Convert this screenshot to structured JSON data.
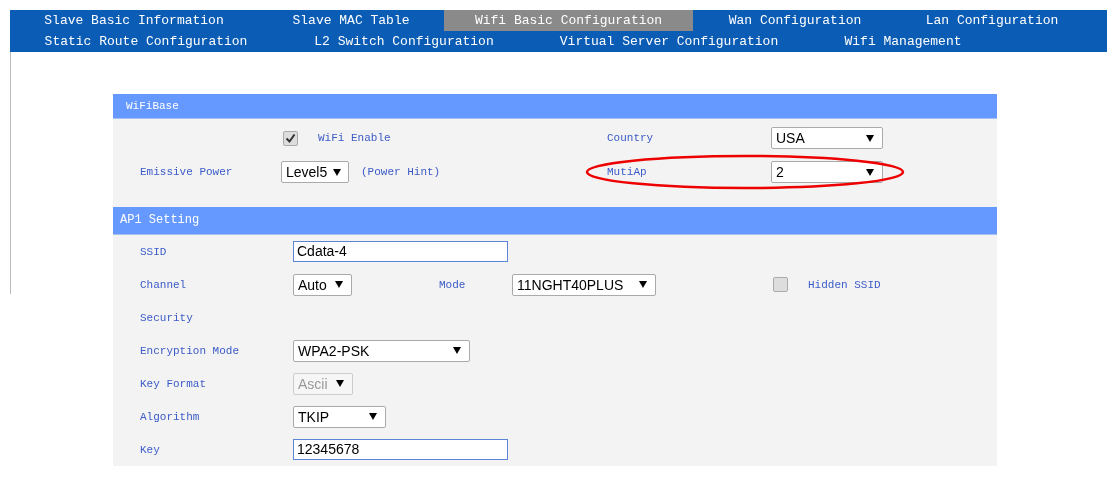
{
  "nav_tabs": [
    [
      {
        "label": "Slave Basic Information",
        "selected": false
      },
      {
        "label": "Slave MAC Table",
        "selected": false
      },
      {
        "label": "Wifi Basic Configuration",
        "selected": true
      },
      {
        "label": "Wan Configuration",
        "selected": false
      },
      {
        "label": "Lan Configuration",
        "selected": false
      }
    ],
    [
      {
        "label": "Static Route Configuration",
        "selected": false
      },
      {
        "label": "L2 Switch Configuration",
        "selected": false
      },
      {
        "label": "Virtual Server Configuration",
        "selected": false
      },
      {
        "label": "Wifi Management",
        "selected": false
      }
    ]
  ],
  "wifi_base": {
    "title": "WiFiBase",
    "wifi_enable": {
      "label": "WiFi Enable",
      "checked": true
    },
    "country": {
      "label": "Country",
      "value": "USA"
    },
    "emissive_power": {
      "label": "Emissive Power",
      "value": "Level5",
      "hint": "(Power Hint)"
    },
    "muti_ap": {
      "label": "MutiAp",
      "value": "2",
      "highlighted": true
    }
  },
  "ap1_setting": {
    "title": "AP1 Setting",
    "ssid": {
      "label": "SSID",
      "value": "Cdata-4"
    },
    "channel": {
      "label": "Channel",
      "value": "Auto"
    },
    "mode": {
      "label": "Mode",
      "value": "11NGHT40PLUS"
    },
    "hidden_ssid": {
      "label": "Hidden SSID",
      "checked": false
    },
    "security": {
      "label": "Security"
    },
    "encryption_mode": {
      "label": "Encryption Mode",
      "value": "WPA2-PSK"
    },
    "key_format": {
      "label": "Key Format",
      "value": "Ascii",
      "disabled": true
    },
    "algorithm": {
      "label": "Algorithm",
      "value": "TKIP"
    },
    "key": {
      "label": "Key",
      "value": "12345678"
    }
  }
}
